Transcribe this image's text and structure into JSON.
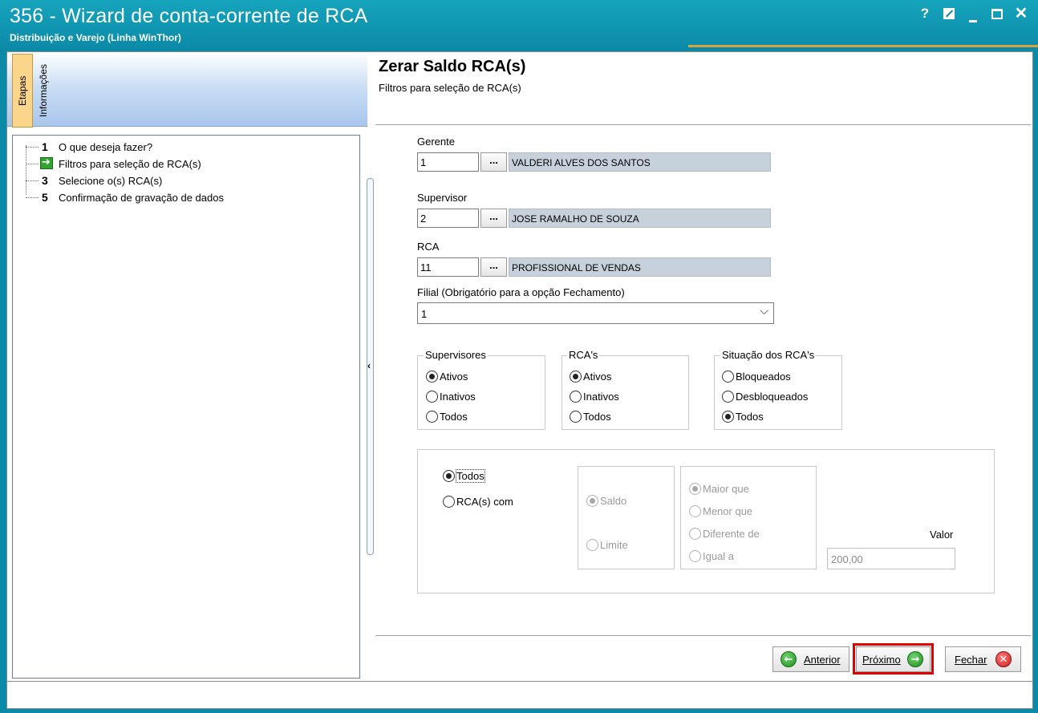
{
  "window": {
    "title": "356 - Wizard de conta-corrente de RCA",
    "subtitle": "Distribuição e Varejo (Linha WinThor)",
    "controls": {
      "help": "?",
      "close": "✕"
    }
  },
  "sidebar": {
    "tabs": {
      "etapas": "Etapas",
      "informacoes": "Informações"
    },
    "steps": [
      {
        "num": "1",
        "label": "O que deseja fazer?"
      },
      {
        "num": "",
        "label": "Filtros para seleção de RCA(s)",
        "current": true,
        "icon": "arrow-right-icon"
      },
      {
        "num": "3",
        "label": "Selecione o(s) RCA(s)"
      },
      {
        "num": "5",
        "label": "Confirmação de gravação de dados"
      }
    ]
  },
  "header": {
    "title": "Zerar Saldo RCA(s)",
    "subtitle": "Filtros para seleção de RCA(s)"
  },
  "form": {
    "gerente": {
      "label": "Gerente",
      "code": "1",
      "button": "...",
      "name": "VALDERI ALVES DOS SANTOS"
    },
    "supervisor": {
      "label": "Supervisor",
      "code": "2",
      "button": "...",
      "name": "JOSE RAMALHO DE SOUZA"
    },
    "rca": {
      "label": "RCA",
      "code": "11",
      "button": "...",
      "name": "PROFISSIONAL DE VENDAS"
    },
    "filial": {
      "label": "Filial (Obrigatório para a opção Fechamento)",
      "value": "1"
    }
  },
  "groups": {
    "supervisores": {
      "title": "Supervisores",
      "options": [
        "Ativos",
        "Inativos",
        "Todos"
      ],
      "selected": "Ativos"
    },
    "rcas": {
      "title": "RCA's",
      "options": [
        "Ativos",
        "Inativos",
        "Todos"
      ],
      "selected": "Ativos"
    },
    "situacao": {
      "title": "Situação dos RCA's",
      "options": [
        "Bloqueados",
        "Desbloqueados",
        "Todos"
      ],
      "selected": "Todos"
    }
  },
  "saldo_filter": {
    "mode_options": [
      "Todos",
      "RCA(s) com"
    ],
    "mode_selected": "Todos",
    "tipo_options": [
      "Saldo",
      "Limite"
    ],
    "tipo_selected": "Saldo",
    "comparador_options": [
      "Maior que",
      "Menor que",
      "Diferente de",
      "Igual a"
    ],
    "comparador_selected": "Maior que",
    "valor_label": "Valor",
    "valor": "200,00"
  },
  "buttons": {
    "anterior": "Anterior",
    "proximo": "Próximo",
    "fechar": "Fechar"
  },
  "colors": {
    "titlebar": "#0b8aa8",
    "highlight": "#e00000",
    "accent_gold": "#d8a53c"
  }
}
